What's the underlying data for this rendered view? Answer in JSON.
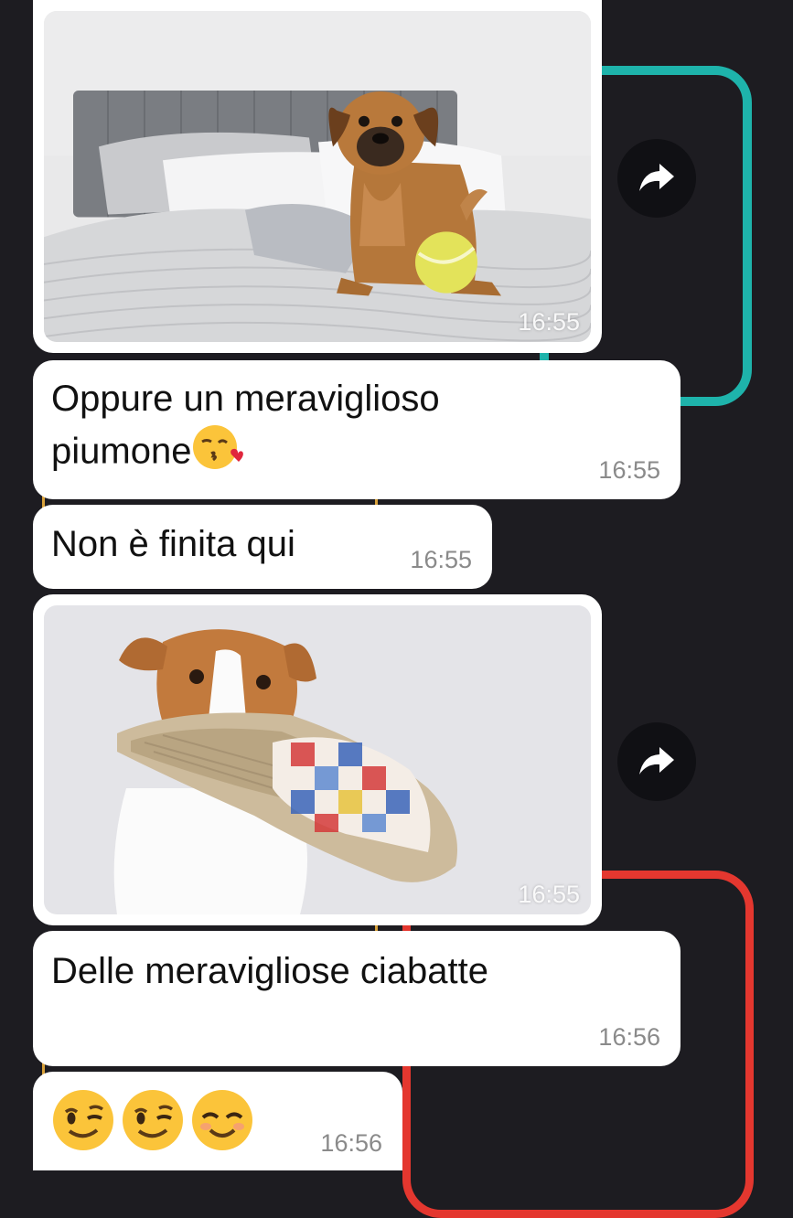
{
  "messages": [
    {
      "type": "image",
      "subject": "dog-on-bed-photo",
      "time": "16:55"
    },
    {
      "type": "text",
      "line1": "Oppure un meraviglioso",
      "line2": "piumone",
      "emoji": "kissing-heart-emoji",
      "time": "16:55"
    },
    {
      "type": "text",
      "text": "Non è finita qui",
      "time": "16:55"
    },
    {
      "type": "image",
      "subject": "dog-with-slipper-photo",
      "time": "16:55"
    },
    {
      "type": "text",
      "text": "Delle meravigliose ciabatte",
      "time": "16:56"
    },
    {
      "type": "emoji",
      "emojis": [
        "winking-face-emoji",
        "winking-face-emoji",
        "smiling-face-emoji"
      ],
      "time": "16:56"
    }
  ],
  "forward_icon": "forward-arrow-icon",
  "colors": {
    "background": "#1d1c21",
    "bubble": "#ffffff",
    "accent_teal": "#1eb3ab",
    "accent_red": "#e4372f",
    "accent_gold": "#d9a23b",
    "timestamp": "#8a8a8a"
  }
}
